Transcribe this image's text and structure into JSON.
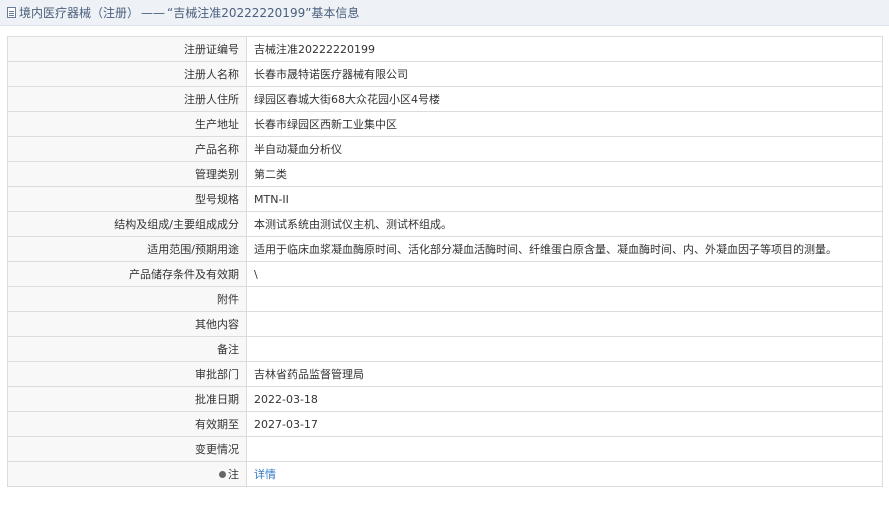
{
  "header": {
    "section": "境内医疗器械（注册）",
    "separator": "——",
    "record_title": "“吉械注准20222220199”基本信息"
  },
  "rows": [
    {
      "label": "注册证编号",
      "value": "吉械注准20222220199"
    },
    {
      "label": "注册人名称",
      "value": "长春市晟特诺医疗器械有限公司"
    },
    {
      "label": "注册人住所",
      "value": "绿园区春城大街68大众花园小区4号楼"
    },
    {
      "label": "生产地址",
      "value": "长春市绿园区西新工业集中区"
    },
    {
      "label": "产品名称",
      "value": "半自动凝血分析仪"
    },
    {
      "label": "管理类别",
      "value": "第二类"
    },
    {
      "label": "型号规格",
      "value": "MTN-II"
    },
    {
      "label": "结构及组成/主要组成成分",
      "value": "本测试系统由测试仪主机、测试杯组成。"
    },
    {
      "label": "适用范围/预期用途",
      "value": "适用于临床血浆凝血酶原时间、活化部分凝血活酶时间、纤维蛋白原含量、凝血酶时间、内、外凝血因子等项目的测量。"
    },
    {
      "label": "产品储存条件及有效期",
      "value": "\\"
    },
    {
      "label": "附件",
      "value": ""
    },
    {
      "label": "其他内容",
      "value": ""
    },
    {
      "label": "备注",
      "value": ""
    },
    {
      "label": "审批部门",
      "value": "吉林省药品监督管理局"
    },
    {
      "label": "批准日期",
      "value": "2022-03-18"
    },
    {
      "label": "有效期至",
      "value": "2027-03-17"
    },
    {
      "label": "变更情况",
      "value": ""
    }
  ],
  "note_row": {
    "icon": "pin-icon",
    "label": "注",
    "link_text": "详情"
  },
  "colors": {
    "link": "#2f78c4",
    "header_bg": "#eef1f6",
    "label_bg": "#f8f8f8",
    "border": "#dcdcdc"
  }
}
